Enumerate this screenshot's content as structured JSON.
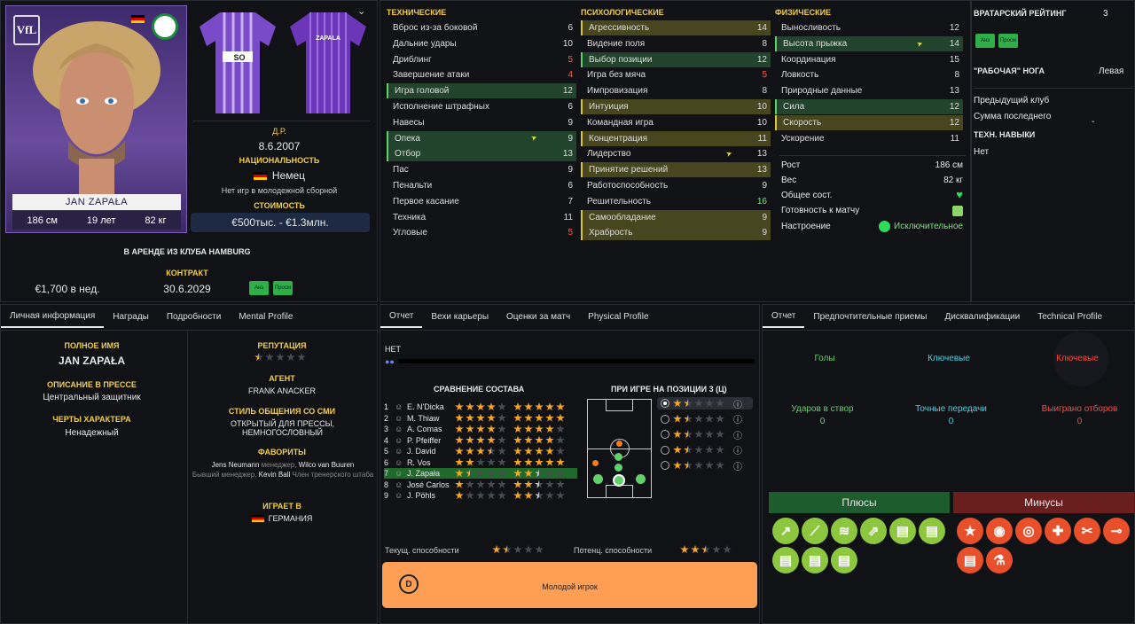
{
  "player": {
    "name": "JAN ZAPAŁA",
    "height": "186 см",
    "age": "19 лет",
    "weight": "82 кг",
    "dob_label": "Д.Р.",
    "dob": "8.6.2007",
    "nationality_label": "НАЦИОНАЛЬНОСТЬ",
    "nationality": "Немец",
    "youth": "Нет игр в молодежной сборной",
    "value_label": "СТОИМОСТЬ",
    "value": "€500тыс. - €1.3млн.",
    "loan": "В АРЕНДЕ ИЗ КЛУБА HAMBURG",
    "contract_label": "КОНТРАКТ",
    "wage": "€1,700 в нед.",
    "contract_end": "30.6.2029",
    "btn_a": "Анз",
    "btn_b": "Просм",
    "club_abbr": "VfL",
    "kit_sponsor": "SO",
    "kit_name": "ZAPALA"
  },
  "attributes": {
    "technical_title": "ТЕХНИЧЕСКИЕ",
    "mental_title": "ПСИХОЛОГИЧЕСКИЕ",
    "physical_title": "ФИЗИЧЕСКИЕ",
    "technical": [
      {
        "n": "Вброс из-за боковой",
        "v": "6"
      },
      {
        "n": "Дальние удары",
        "v": "10"
      },
      {
        "n": "Дриблинг",
        "v": "5"
      },
      {
        "n": "Завершение атаки",
        "v": "4"
      },
      {
        "n": "Игра головой",
        "v": "12"
      },
      {
        "n": "Исполнение штрафных",
        "v": "6"
      },
      {
        "n": "Навесы",
        "v": "9"
      },
      {
        "n": "Опека",
        "v": "9"
      },
      {
        "n": "Отбор",
        "v": "13"
      },
      {
        "n": "Пас",
        "v": "9"
      },
      {
        "n": "Пенальти",
        "v": "6"
      },
      {
        "n": "Первое касание",
        "v": "7"
      },
      {
        "n": "Техника",
        "v": "11"
      },
      {
        "n": "Угловые",
        "v": "5"
      }
    ],
    "mental": [
      {
        "n": "Агрессивность",
        "v": "14"
      },
      {
        "n": "Видение поля",
        "v": "8"
      },
      {
        "n": "Выбор позиции",
        "v": "12"
      },
      {
        "n": "Игра без мяча",
        "v": "5"
      },
      {
        "n": "Импровизация",
        "v": "8"
      },
      {
        "n": "Интуиция",
        "v": "10"
      },
      {
        "n": "Командная игра",
        "v": "10"
      },
      {
        "n": "Концентрация",
        "v": "11"
      },
      {
        "n": "Лидерство",
        "v": "13"
      },
      {
        "n": "Принятие решений",
        "v": "13"
      },
      {
        "n": "Работоспособность",
        "v": "9"
      },
      {
        "n": "Решительность",
        "v": "16"
      },
      {
        "n": "Самообладание",
        "v": "9"
      },
      {
        "n": "Храбрость",
        "v": "9"
      }
    ],
    "physical": [
      {
        "n": "Выносливость",
        "v": "12"
      },
      {
        "n": "Высота прыжка",
        "v": "14"
      },
      {
        "n": "Координация",
        "v": "15"
      },
      {
        "n": "Ловкость",
        "v": "8"
      },
      {
        "n": "Природные данные",
        "v": "13"
      },
      {
        "n": "Сила",
        "v": "12"
      },
      {
        "n": "Скорость",
        "v": "12"
      },
      {
        "n": "Ускорение",
        "v": "11"
      }
    ],
    "height_label": "Рост",
    "height": "186 см",
    "weight_label": "Вес",
    "weight": "82 кг",
    "condition_label": "Общее сост.",
    "match_label": "Готовность к матчу",
    "morale_label": "Настроение",
    "morale": "Исключительное"
  },
  "side": {
    "gk_label": "ВРАТАРСКИЙ РЕЙТИНГ",
    "gk_value": "3",
    "foot_label": "\"РАБОЧАЯ\" НОГА",
    "foot": "Левая",
    "prev_club": "Предыдущий клуб",
    "last_fee": "Сумма последнего",
    "last_fee_value": "-",
    "tech_label": "ТЕХН. НАВЫКИ",
    "tech_value": "Нет"
  },
  "tabs_left": [
    "Личная информация",
    "Награды",
    "Подробности",
    "Mental Profile"
  ],
  "tabs_mid": [
    "Отчет",
    "Вехи карьеры",
    "Оценки за матч",
    "Physical Profile"
  ],
  "tabs_right": [
    "Отчет",
    "Предпочтительные приемы",
    "Дисквалификации",
    "Technical Profile"
  ],
  "personal": {
    "full_name_label": "ПОЛНОЕ ИМЯ",
    "full_name": "JAN ZAPAŁA",
    "press_label": "ОПИСАНИЕ В ПРЕССЕ",
    "press": "Центральный защитник",
    "traits_label": "ЧЕРТЫ ХАРАКТЕРА",
    "traits": "Ненадежный",
    "rep_label": "РЕПУТАЦИЯ",
    "agent_label": "АГЕНТ",
    "agent": "FRANK ANACKER",
    "media_label": "СТИЛЬ ОБЩЕНИЯ СО СМИ",
    "media": "ОТКРЫТЫЙ ДЛЯ ПРЕССЫ, НЕМНОГОСЛОВНЫЙ",
    "fav_label": "ФАВОРИТЫ",
    "fav1_name": "Jens Neumann",
    "fav1_role": "менеджер,",
    "fav2_name": "Wilco van Buuren",
    "fav2_role": "Бывший менеджер,",
    "fav3_name": "Kevin Ball",
    "fav3_role": "Член тренерского штаба",
    "plays_label": "ИГРАЕТ В",
    "plays": "ГЕРМАНИЯ"
  },
  "report": {
    "none": "НЕТ",
    "squad_title": "СРАВНЕНИЕ СОСТАВА",
    "position_title": "ПРИ ИГРЕ НА ПОЗИЦИИ 3 (Ц)",
    "current_label": "Текущ. способности",
    "potential_label": "Потенц. способности",
    "banner": "Молодой игрок",
    "banner_grade": "D",
    "squad": [
      {
        "n": "1",
        "name": "E. N'Dicka",
        "ca": 4,
        "pa": 5
      },
      {
        "n": "2",
        "name": "M. Thiaw",
        "ca": 4,
        "pa": 5
      },
      {
        "n": "3",
        "name": "A. Comas",
        "ca": 4,
        "pa": 4
      },
      {
        "n": "4",
        "name": "P. Pfeiffer",
        "ca": 4,
        "pa": 4
      },
      {
        "n": "5",
        "name": "J. David",
        "ca": 3.5,
        "pa": 4
      },
      {
        "n": "6",
        "name": "R. Vos",
        "ca": 2,
        "pa": 5
      },
      {
        "n": "7",
        "name": "J. Zapała",
        "ca": 1.5,
        "pa": 2.5
      },
      {
        "n": "8",
        "name": "José Carlos",
        "ca": 1,
        "pa": 2.5
      },
      {
        "n": "9",
        "name": "J. Pöhls",
        "ca": 1,
        "pa": 2.5
      }
    ]
  },
  "scout": {
    "goals": "Голы",
    "key1": "Ключевые",
    "key2": "Ключевые",
    "shots_label": "Ударов в створ",
    "shots": "0",
    "passes_label": "Точные передачи",
    "passes": "0",
    "tackles_label": "Выиграно отборов",
    "tackles": "0",
    "pros": "Плюсы",
    "cons": "Минусы"
  },
  "colors": {
    "accent_yellow": "#f2cf46",
    "good": "#5fd16a",
    "bad": "#e8502b",
    "pro_bg": "#1f5c2d",
    "con_bg": "#6b1e1e"
  }
}
